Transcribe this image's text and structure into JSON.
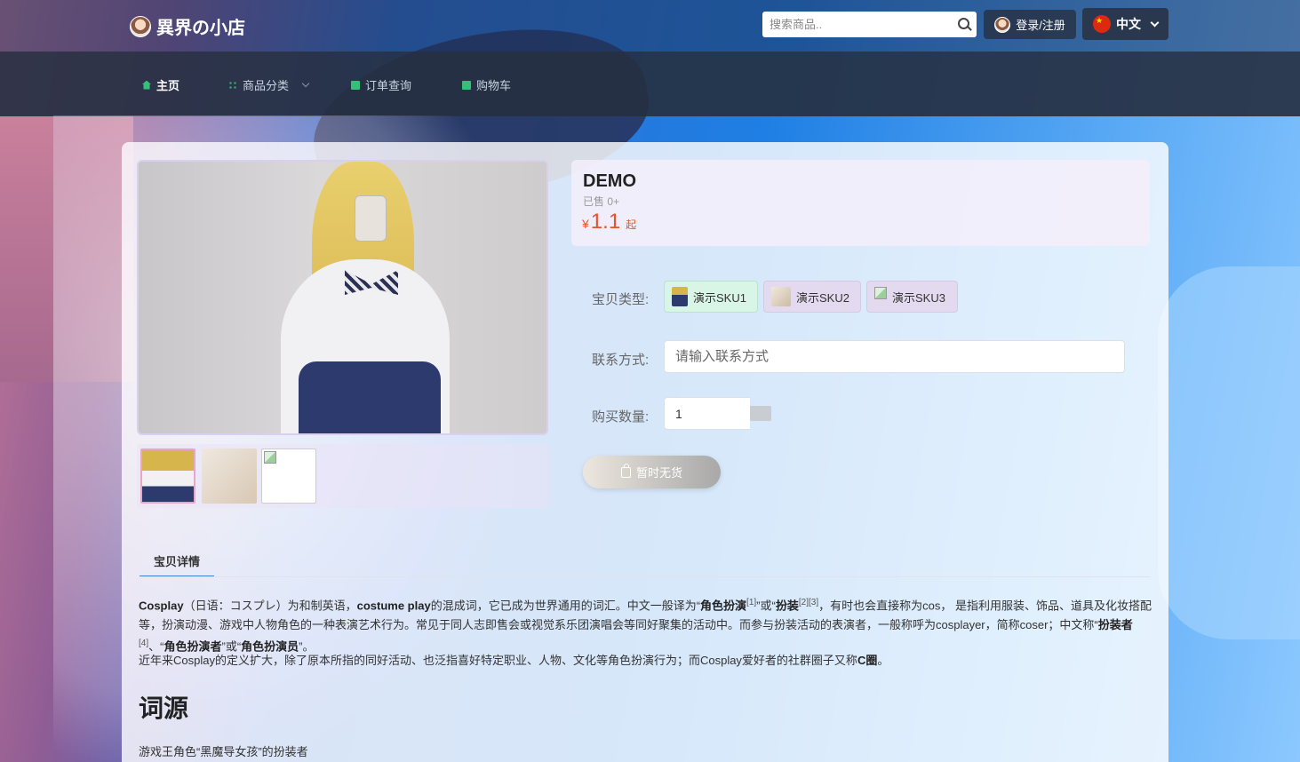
{
  "header": {
    "site_name": "異界の小店",
    "search_placeholder": "搜索商品..",
    "login_label": "登录/注册",
    "language_label": "中文"
  },
  "nav": {
    "items": [
      {
        "label": "主页",
        "icon": "home-icon",
        "active": true
      },
      {
        "label": "商品分类",
        "icon": "grid-icon",
        "has_dropdown": true
      },
      {
        "label": "订单查询",
        "icon": "order-icon"
      },
      {
        "label": "购物车",
        "icon": "cart-icon"
      }
    ]
  },
  "product": {
    "title": "DEMO",
    "sold": "已售 0+",
    "price_currency": "¥",
    "price_value": "1.1",
    "price_suffix": "起",
    "sku_label": "宝贝类型:",
    "skus": [
      "演示SKU1",
      "演示SKU2",
      "演示SKU3"
    ],
    "contact_label": "联系方式:",
    "contact_placeholder": "请输入联系方式",
    "quantity_label": "购买数量:",
    "quantity_value": "1",
    "buy_button_label": "暂时无货"
  },
  "tabs": {
    "detail_label": "宝贝详情"
  },
  "detail": {
    "p1": {
      "term": "Cosplay",
      "t1": "（日语：コスプレ）为和制英语，",
      "term2": "costume play",
      "t2": "的混成词，它已成为世界通用的词汇。中文一般译为“",
      "term3": "角色扮演",
      "ref1": "[1]",
      "t3": "”或“",
      "term4": "扮装",
      "ref2": "[2][3]",
      "t4": "，有时也会直接称为cos， 是指利用服装、饰品、道具及化妆搭配等，扮演动漫、游戏中人物角色的一种表演艺术行为。常见于同人志即售会或视觉系乐团演唱会等同好聚集的活动中。而参与扮装活动的表演者，一般称呼为cosplayer，简称coser；中文称“",
      "term5": "扮装者",
      "ref3": "[4]",
      "t5": "、“",
      "term6": "角色扮演者",
      "t6": "”或“",
      "term7": "角色扮演员",
      "t7": "”。"
    },
    "p2_text": "近年来Cosplay的定义扩大，除了原本所指的同好活动、也泛指喜好特定职业、人物、文化等角色扮演行为；而Cosplay爱好者的社群圈子又称",
    "p2_term": "C圈",
    "p2_end": "。",
    "heading": "词源",
    "caption": "游戏王角色“黑魔导女孩”的扮装者"
  },
  "colors": {
    "price": "#e8522f",
    "accent_tab": "#3d86d8",
    "nav_icon": "#35c07a"
  }
}
